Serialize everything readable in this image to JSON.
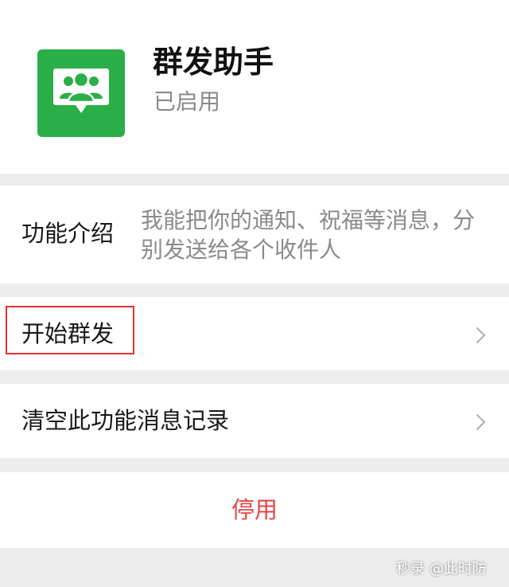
{
  "app": {
    "name": "群发助手",
    "status": "已启用",
    "icon": "group-message-icon",
    "icon_color": "#2aae48"
  },
  "intro": {
    "label": "功能介绍",
    "description": "我能把你的通知、祝福等消息，分别发送给各个收件人"
  },
  "actions": {
    "start_label": "开始群发",
    "clear_label": "清空此功能消息记录",
    "disable_label": "停用",
    "disable_color": "#e64340"
  },
  "annotation": {
    "highlight_color": "#e53131"
  },
  "watermark": "秒录 @此时防"
}
